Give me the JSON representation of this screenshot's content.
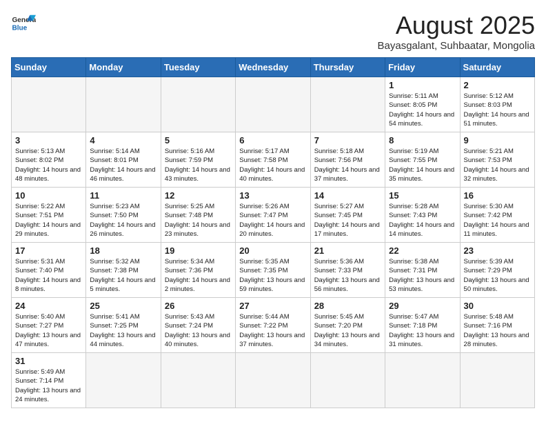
{
  "header": {
    "logo_general": "General",
    "logo_blue": "Blue",
    "title": "August 2025",
    "subtitle": "Bayasgalant, Suhbaatar, Mongolia"
  },
  "weekdays": [
    "Sunday",
    "Monday",
    "Tuesday",
    "Wednesday",
    "Thursday",
    "Friday",
    "Saturday"
  ],
  "weeks": [
    [
      {
        "day": "",
        "info": ""
      },
      {
        "day": "",
        "info": ""
      },
      {
        "day": "",
        "info": ""
      },
      {
        "day": "",
        "info": ""
      },
      {
        "day": "",
        "info": ""
      },
      {
        "day": "1",
        "info": "Sunrise: 5:11 AM\nSunset: 8:05 PM\nDaylight: 14 hours and 54 minutes."
      },
      {
        "day": "2",
        "info": "Sunrise: 5:12 AM\nSunset: 8:03 PM\nDaylight: 14 hours and 51 minutes."
      }
    ],
    [
      {
        "day": "3",
        "info": "Sunrise: 5:13 AM\nSunset: 8:02 PM\nDaylight: 14 hours and 48 minutes."
      },
      {
        "day": "4",
        "info": "Sunrise: 5:14 AM\nSunset: 8:01 PM\nDaylight: 14 hours and 46 minutes."
      },
      {
        "day": "5",
        "info": "Sunrise: 5:16 AM\nSunset: 7:59 PM\nDaylight: 14 hours and 43 minutes."
      },
      {
        "day": "6",
        "info": "Sunrise: 5:17 AM\nSunset: 7:58 PM\nDaylight: 14 hours and 40 minutes."
      },
      {
        "day": "7",
        "info": "Sunrise: 5:18 AM\nSunset: 7:56 PM\nDaylight: 14 hours and 37 minutes."
      },
      {
        "day": "8",
        "info": "Sunrise: 5:19 AM\nSunset: 7:55 PM\nDaylight: 14 hours and 35 minutes."
      },
      {
        "day": "9",
        "info": "Sunrise: 5:21 AM\nSunset: 7:53 PM\nDaylight: 14 hours and 32 minutes."
      }
    ],
    [
      {
        "day": "10",
        "info": "Sunrise: 5:22 AM\nSunset: 7:51 PM\nDaylight: 14 hours and 29 minutes."
      },
      {
        "day": "11",
        "info": "Sunrise: 5:23 AM\nSunset: 7:50 PM\nDaylight: 14 hours and 26 minutes."
      },
      {
        "day": "12",
        "info": "Sunrise: 5:25 AM\nSunset: 7:48 PM\nDaylight: 14 hours and 23 minutes."
      },
      {
        "day": "13",
        "info": "Sunrise: 5:26 AM\nSunset: 7:47 PM\nDaylight: 14 hours and 20 minutes."
      },
      {
        "day": "14",
        "info": "Sunrise: 5:27 AM\nSunset: 7:45 PM\nDaylight: 14 hours and 17 minutes."
      },
      {
        "day": "15",
        "info": "Sunrise: 5:28 AM\nSunset: 7:43 PM\nDaylight: 14 hours and 14 minutes."
      },
      {
        "day": "16",
        "info": "Sunrise: 5:30 AM\nSunset: 7:42 PM\nDaylight: 14 hours and 11 minutes."
      }
    ],
    [
      {
        "day": "17",
        "info": "Sunrise: 5:31 AM\nSunset: 7:40 PM\nDaylight: 14 hours and 8 minutes."
      },
      {
        "day": "18",
        "info": "Sunrise: 5:32 AM\nSunset: 7:38 PM\nDaylight: 14 hours and 5 minutes."
      },
      {
        "day": "19",
        "info": "Sunrise: 5:34 AM\nSunset: 7:36 PM\nDaylight: 14 hours and 2 minutes."
      },
      {
        "day": "20",
        "info": "Sunrise: 5:35 AM\nSunset: 7:35 PM\nDaylight: 13 hours and 59 minutes."
      },
      {
        "day": "21",
        "info": "Sunrise: 5:36 AM\nSunset: 7:33 PM\nDaylight: 13 hours and 56 minutes."
      },
      {
        "day": "22",
        "info": "Sunrise: 5:38 AM\nSunset: 7:31 PM\nDaylight: 13 hours and 53 minutes."
      },
      {
        "day": "23",
        "info": "Sunrise: 5:39 AM\nSunset: 7:29 PM\nDaylight: 13 hours and 50 minutes."
      }
    ],
    [
      {
        "day": "24",
        "info": "Sunrise: 5:40 AM\nSunset: 7:27 PM\nDaylight: 13 hours and 47 minutes."
      },
      {
        "day": "25",
        "info": "Sunrise: 5:41 AM\nSunset: 7:25 PM\nDaylight: 13 hours and 44 minutes."
      },
      {
        "day": "26",
        "info": "Sunrise: 5:43 AM\nSunset: 7:24 PM\nDaylight: 13 hours and 40 minutes."
      },
      {
        "day": "27",
        "info": "Sunrise: 5:44 AM\nSunset: 7:22 PM\nDaylight: 13 hours and 37 minutes."
      },
      {
        "day": "28",
        "info": "Sunrise: 5:45 AM\nSunset: 7:20 PM\nDaylight: 13 hours and 34 minutes."
      },
      {
        "day": "29",
        "info": "Sunrise: 5:47 AM\nSunset: 7:18 PM\nDaylight: 13 hours and 31 minutes."
      },
      {
        "day": "30",
        "info": "Sunrise: 5:48 AM\nSunset: 7:16 PM\nDaylight: 13 hours and 28 minutes."
      }
    ],
    [
      {
        "day": "31",
        "info": "Sunrise: 5:49 AM\nSunset: 7:14 PM\nDaylight: 13 hours and 24 minutes."
      },
      {
        "day": "",
        "info": ""
      },
      {
        "day": "",
        "info": ""
      },
      {
        "day": "",
        "info": ""
      },
      {
        "day": "",
        "info": ""
      },
      {
        "day": "",
        "info": ""
      },
      {
        "day": "",
        "info": ""
      }
    ]
  ]
}
